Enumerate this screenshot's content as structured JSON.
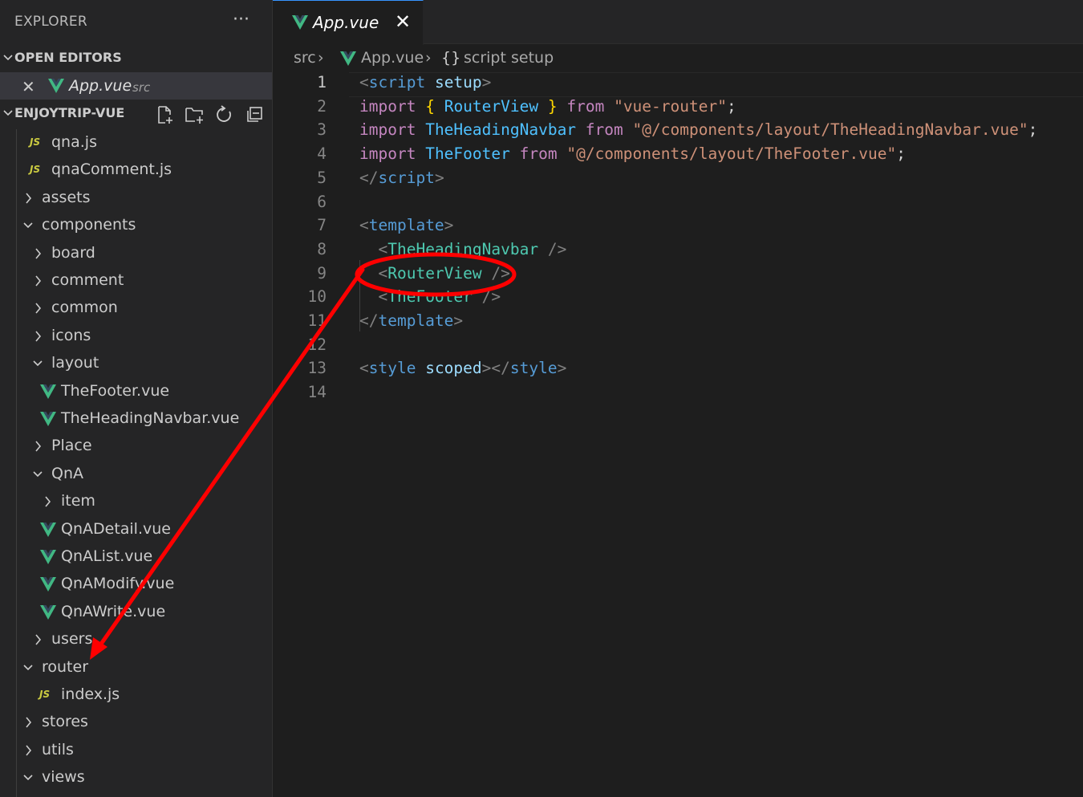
{
  "explorer": {
    "title": "EXPLORER",
    "more": "···",
    "open_editors_label": "OPEN EDITORS",
    "open_editor_item": {
      "name": "App.vue",
      "dir": "src",
      "close": "✕"
    },
    "project_label": "ENJOYTRIP-VUE",
    "tree": [
      {
        "label": "qna.js",
        "type": "js",
        "indent": 1
      },
      {
        "label": "qnaComment.js",
        "type": "js",
        "indent": 1
      },
      {
        "label": "assets",
        "type": "folder-closed",
        "indent": 1
      },
      {
        "label": "components",
        "type": "folder-open",
        "indent": 1
      },
      {
        "label": "board",
        "type": "folder-closed",
        "indent": 2
      },
      {
        "label": "comment",
        "type": "folder-closed",
        "indent": 2
      },
      {
        "label": "common",
        "type": "folder-closed",
        "indent": 2
      },
      {
        "label": "icons",
        "type": "folder-closed",
        "indent": 2
      },
      {
        "label": "layout",
        "type": "folder-open",
        "indent": 2
      },
      {
        "label": "TheFooter.vue",
        "type": "vue",
        "indent": 3
      },
      {
        "label": "TheHeadingNavbar.vue",
        "type": "vue",
        "indent": 3
      },
      {
        "label": "Place",
        "type": "folder-closed",
        "indent": 2
      },
      {
        "label": "QnA",
        "type": "folder-open",
        "indent": 2
      },
      {
        "label": "item",
        "type": "folder-closed",
        "indent": 3
      },
      {
        "label": "QnADetail.vue",
        "type": "vue",
        "indent": 3
      },
      {
        "label": "QnAList.vue",
        "type": "vue",
        "indent": 3
      },
      {
        "label": "QnAModify.vue",
        "type": "vue",
        "indent": 3
      },
      {
        "label": "QnAWrite.vue",
        "type": "vue",
        "indent": 3
      },
      {
        "label": "users",
        "type": "folder-closed",
        "indent": 2
      },
      {
        "label": "router",
        "type": "folder-open",
        "indent": 1
      },
      {
        "label": "index.js",
        "type": "js",
        "indent": 2
      },
      {
        "label": "stores",
        "type": "folder-closed",
        "indent": 1
      },
      {
        "label": "utils",
        "type": "folder-closed",
        "indent": 1
      },
      {
        "label": "views",
        "type": "folder-open",
        "indent": 1
      }
    ],
    "js_badge": "JS"
  },
  "tab": {
    "name": "App.vue",
    "close": "✕"
  },
  "breadcrumb": {
    "folder": "src",
    "file": "App.vue",
    "symbol_icon": "{}",
    "symbol": "script setup",
    "separator": "›"
  },
  "editor": {
    "active_line": 1,
    "lines": [
      {
        "n": "1",
        "tokens": [
          [
            "c-tag",
            "<"
          ],
          [
            "c-tagname",
            "script"
          ],
          [
            "c-plain",
            " "
          ],
          [
            "c-attr",
            "setup"
          ],
          [
            "c-tag",
            ">"
          ]
        ]
      },
      {
        "n": "2",
        "tokens": [
          [
            "c-kw",
            "import"
          ],
          [
            "c-plain",
            " "
          ],
          [
            "c-brace",
            "{"
          ],
          [
            "c-plain",
            " "
          ],
          [
            "c-var",
            "RouterView"
          ],
          [
            "c-plain",
            " "
          ],
          [
            "c-brace",
            "}"
          ],
          [
            "c-plain",
            " "
          ],
          [
            "c-kw",
            "from"
          ],
          [
            "c-plain",
            " "
          ],
          [
            "c-str",
            "\"vue-router\""
          ],
          [
            "c-plain",
            ";"
          ]
        ]
      },
      {
        "n": "3",
        "tokens": [
          [
            "c-kw",
            "import"
          ],
          [
            "c-plain",
            " "
          ],
          [
            "c-var",
            "TheHeadingNavbar"
          ],
          [
            "c-plain",
            " "
          ],
          [
            "c-kw",
            "from"
          ],
          [
            "c-plain",
            " "
          ],
          [
            "c-str",
            "\"@/components/layout/TheHeadingNavbar.vue\""
          ],
          [
            "c-plain",
            ";"
          ]
        ]
      },
      {
        "n": "4",
        "tokens": [
          [
            "c-kw",
            "import"
          ],
          [
            "c-plain",
            " "
          ],
          [
            "c-var",
            "TheFooter"
          ],
          [
            "c-plain",
            " "
          ],
          [
            "c-kw",
            "from"
          ],
          [
            "c-plain",
            " "
          ],
          [
            "c-str",
            "\"@/components/layout/TheFooter.vue\""
          ],
          [
            "c-plain",
            ";"
          ]
        ]
      },
      {
        "n": "5",
        "tokens": [
          [
            "c-tag",
            "</"
          ],
          [
            "c-tagname",
            "script"
          ],
          [
            "c-tag",
            ">"
          ]
        ]
      },
      {
        "n": "6",
        "tokens": []
      },
      {
        "n": "7",
        "tokens": [
          [
            "c-tag",
            "<"
          ],
          [
            "c-tagname",
            "template"
          ],
          [
            "c-tag",
            ">"
          ]
        ]
      },
      {
        "n": "8",
        "tokens": [
          [
            "c-plain",
            "  "
          ],
          [
            "c-tag",
            "<"
          ],
          [
            "c-comp",
            "TheHeadingNavbar"
          ],
          [
            "c-plain",
            " "
          ],
          [
            "c-tag",
            "/>"
          ]
        ]
      },
      {
        "n": "9",
        "tokens": [
          [
            "c-plain",
            "  "
          ],
          [
            "c-tag",
            "<"
          ],
          [
            "c-comp",
            "RouterView"
          ],
          [
            "c-plain",
            " "
          ],
          [
            "c-tag",
            "/>"
          ]
        ]
      },
      {
        "n": "10",
        "tokens": [
          [
            "c-plain",
            "  "
          ],
          [
            "c-tag",
            "<"
          ],
          [
            "c-comp",
            "TheFooter"
          ],
          [
            "c-plain",
            " "
          ],
          [
            "c-tag",
            "/>"
          ]
        ]
      },
      {
        "n": "11",
        "tokens": [
          [
            "c-tag",
            "</"
          ],
          [
            "c-tagname",
            "template"
          ],
          [
            "c-tag",
            ">"
          ]
        ]
      },
      {
        "n": "12",
        "tokens": []
      },
      {
        "n": "13",
        "tokens": [
          [
            "c-tag",
            "<"
          ],
          [
            "c-tagname",
            "style"
          ],
          [
            "c-plain",
            " "
          ],
          [
            "c-attr",
            "scoped"
          ],
          [
            "c-tag",
            "></"
          ],
          [
            "c-tagname",
            "style"
          ],
          [
            "c-tag",
            ">"
          ]
        ]
      },
      {
        "n": "14",
        "tokens": []
      }
    ]
  },
  "colors": {
    "annotation": "#ff0000",
    "vue_green": "#41b883",
    "js_yellow": "#cbcb41",
    "accent": "#3794ff"
  }
}
